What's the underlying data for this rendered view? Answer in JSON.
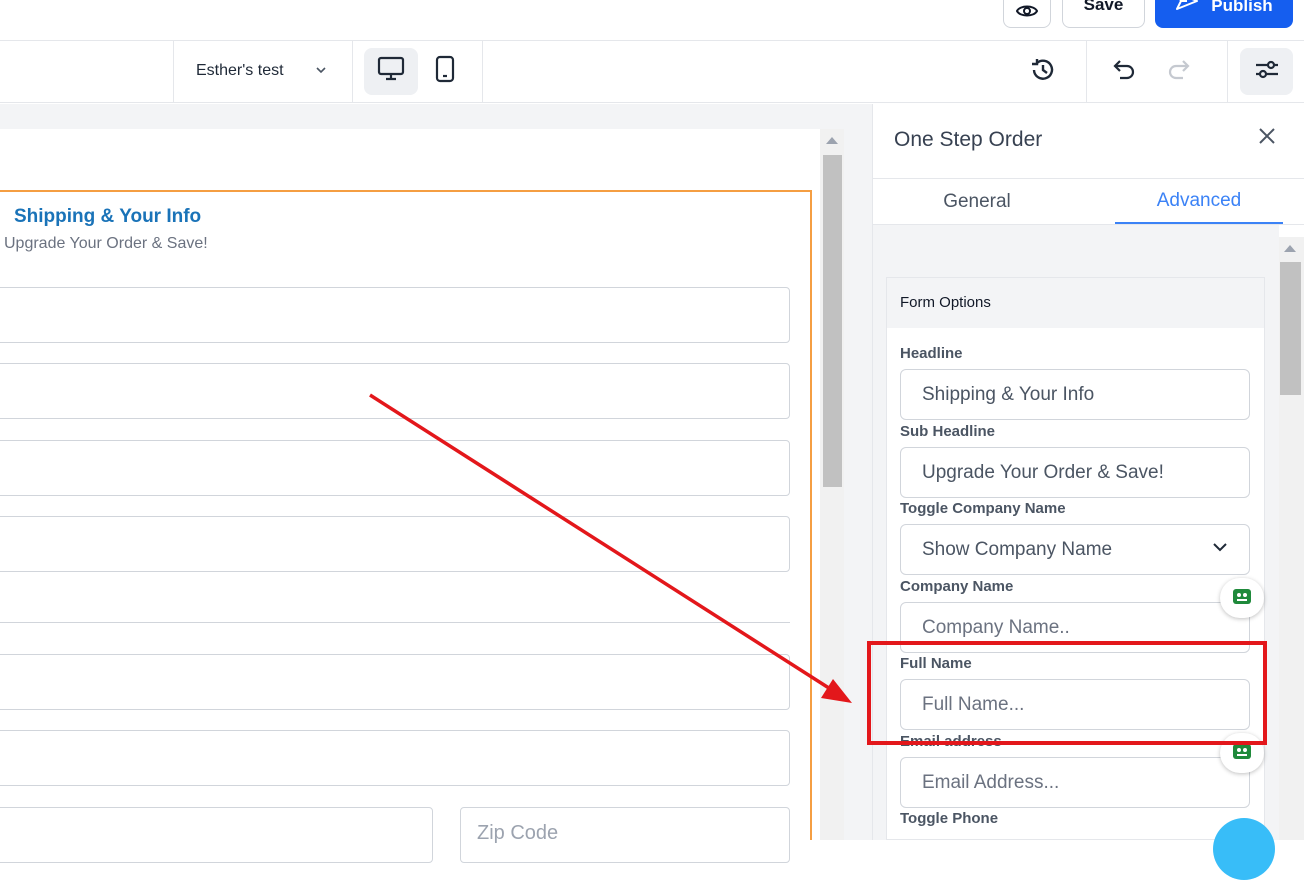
{
  "topbar": {
    "save_label": "Save",
    "publish_label": "Publish"
  },
  "toolbar": {
    "page_name": "Esther's test"
  },
  "canvas": {
    "form_headline": "Shipping & Your Info",
    "form_subheadline": "Upgrade Your Order & Save!",
    "zip_placeholder": "Zip Code"
  },
  "panel": {
    "title": "One Step Order",
    "tabs": [
      {
        "label": "General",
        "active": false
      },
      {
        "label": "Advanced",
        "active": true
      }
    ],
    "section_title": "Form Options",
    "fields": {
      "headline": {
        "label": "Headline",
        "value": "Shipping & Your Info"
      },
      "sub_headline": {
        "label": "Sub Headline",
        "value": "Upgrade Your Order & Save!"
      },
      "toggle_company": {
        "label": "Toggle Company Name",
        "value": "Show Company Name"
      },
      "company_name": {
        "label": "Company Name",
        "placeholder": "Company Name.."
      },
      "full_name": {
        "label": "Full Name",
        "placeholder": "Full Name..."
      },
      "email": {
        "label": "Email address",
        "placeholder": "Email Address..."
      },
      "toggle_phone": {
        "label": "Toggle Phone"
      }
    }
  },
  "colors": {
    "accent_blue": "#155eef",
    "tab_active": "#3b82f6",
    "headline_blue": "#1a73b8",
    "annotation_red": "#e3171b",
    "selection_orange": "#f59e42"
  }
}
